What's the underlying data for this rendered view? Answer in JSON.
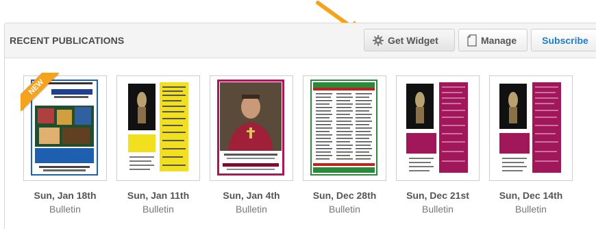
{
  "header": {
    "title": "RECENT PUBLICATIONS",
    "buttons": {
      "get_widget": "Get Widget",
      "manage": "Manage",
      "subscribe": "Subscribe"
    }
  },
  "accent_color": "#1a7ec8",
  "arrow_color": "#f5a21d",
  "publications": [
    {
      "date": "Sun, Jan 18th",
      "type": "Bulletin",
      "badge": "NEW",
      "cover": "open-house-cover"
    },
    {
      "date": "Sun, Jan 11th",
      "type": "Bulletin",
      "cover": "yellow-bulletin-cover"
    },
    {
      "date": "Sun, Jan 4th",
      "type": "Bulletin",
      "cover": "bishop-portrait-cover"
    },
    {
      "date": "Sun, Dec 28th",
      "type": "Bulletin",
      "cover": "green-text-cover"
    },
    {
      "date": "Sun, Dec 21st",
      "type": "Bulletin",
      "cover": "magenta-bulletin-cover"
    },
    {
      "date": "Sun, Dec 14th",
      "type": "Bulletin",
      "cover": "magenta-bulletin-cover"
    }
  ],
  "icons": {
    "widget": "gear-icon",
    "manage": "document-icon"
  }
}
